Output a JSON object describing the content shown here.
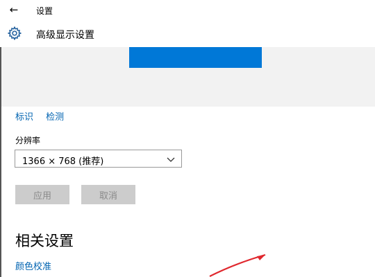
{
  "titlebar": {
    "back_icon": "back-arrow-icon",
    "app_title": "设置"
  },
  "header": {
    "icon": "gear-icon",
    "title": "高级显示设置"
  },
  "preview": {
    "monitor_color": "#0078d7",
    "monitor_label": ""
  },
  "links": {
    "identify": "标识",
    "detect": "检测"
  },
  "resolution": {
    "label": "分辨率",
    "value": "1366 × 768 (推荐)",
    "chevron_icon": "chevron-down-icon"
  },
  "buttons": {
    "apply": "应用",
    "cancel": "取消"
  },
  "related": {
    "title": "相关设置",
    "color_calibration": "颜色校准"
  },
  "annotation": {
    "arrow_color": "#e0282e"
  },
  "colors": {
    "accent": "#0078d7",
    "link": "#0063b1",
    "disabled_button": "#cccccc"
  }
}
